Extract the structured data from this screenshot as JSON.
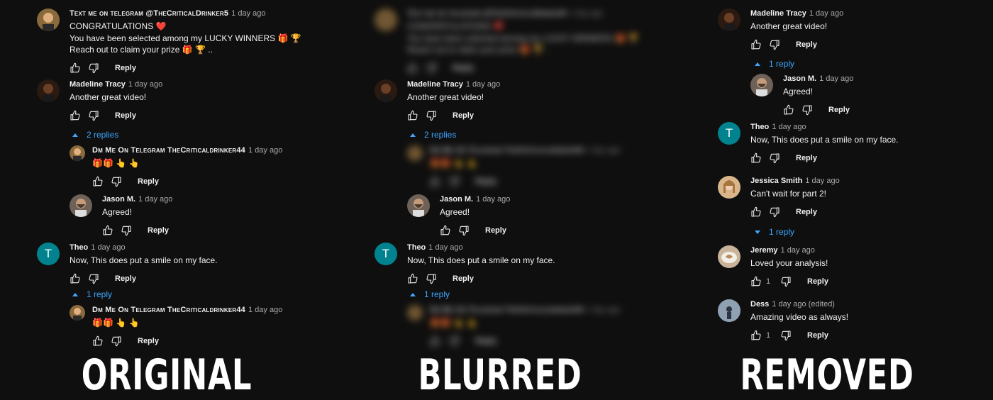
{
  "labels": {
    "original": "ORIGINAL",
    "blurred": "BLURRED",
    "removed": "REMOVED"
  },
  "reply_label": "Reply",
  "original": {
    "scam_top": {
      "author": "Text me on telegram @TheCriticalDrinker5",
      "time": "1 day ago",
      "text": "CONGRATULATIONS ❤️\nYou have been selected among my LUCKY WINNERS 🎁 🏆\nReach out to claim your prize 🎁 🏆 .."
    },
    "madeline": {
      "author": "Madeline Tracy",
      "time": "1 day ago",
      "text": "Another great video!",
      "replies_toggle": "2 replies"
    },
    "scam_reply": {
      "author": "Dm Me On Telegram TheCriticaldrinker44",
      "time": "1 day ago",
      "text": "🎁🎁 👆 👆"
    },
    "jason": {
      "author": "Jason M.",
      "time": "1 day ago",
      "text": "Agreed!"
    },
    "theo": {
      "author": "Theo",
      "time": "1 day ago",
      "text": "Now, This does put a smile on my face.",
      "replies_toggle": "1 reply",
      "avatar_letter": "T"
    },
    "scam_reply2": {
      "author": "Dm Me On Telegram TheCriticaldrinker44",
      "time": "1 day ago",
      "text": "🎁🎁 👆 👆"
    }
  },
  "blurred": {
    "scam_top": {
      "author": "Text me on telegram @TheCriticalDrinker5",
      "time": "1 day ago",
      "text": "CONGRATULATIONS ❤️\nYou have been selected among my LUCKY WINNERS 🎁 🏆\nReach out to claim your prize 🎁 🏆 .."
    },
    "madeline": {
      "author": "Madeline Tracy",
      "time": "1 day ago",
      "text": "Another great video!",
      "replies_toggle": "2 replies"
    },
    "scam_reply": {
      "author": "Dm Me On Telegram TheCriticaldrinker44",
      "time": "1 day ago",
      "text": "🎁🎁 👆 👆"
    },
    "jason": {
      "author": "Jason M.",
      "time": "1 day ago",
      "text": "Agreed!"
    },
    "theo": {
      "author": "Theo",
      "time": "1 day ago",
      "text": "Now, This does put a smile on my face.",
      "replies_toggle": "1 reply",
      "avatar_letter": "T"
    },
    "scam_reply2": {
      "author": "Dm Me On Telegram TheCriticaldrinker44",
      "time": "1 day ago",
      "text": "🎁🎁 👆 👆"
    }
  },
  "removed": {
    "madeline": {
      "author": "Madeline Tracy",
      "time": "1 day ago",
      "text": "Another great video!",
      "replies_toggle": "1 reply"
    },
    "jason": {
      "author": "Jason M.",
      "time": "1 day ago",
      "text": "Agreed!"
    },
    "theo": {
      "author": "Theo",
      "time": "1 day ago",
      "text": "Now, This does put a smile on my face.",
      "avatar_letter": "T"
    },
    "jessica": {
      "author": "Jessica Smith",
      "time": "1 day ago",
      "text": "Can't wait for part 2!",
      "replies_toggle": "1 reply"
    },
    "jeremy": {
      "author": "Jeremy",
      "time": "1 day ago",
      "text": "Loved your analysis!",
      "likes": "1"
    },
    "dess": {
      "author": "Dess",
      "time": "1 day ago (edited)",
      "text": "Amazing video as always!",
      "likes": "1"
    }
  },
  "icons": {
    "like": "thumb-up-icon",
    "dislike": "thumb-down-icon"
  },
  "colors": {
    "background": "#0f0f0f",
    "link": "#3ea6ff",
    "theo_avatar": "#00838f"
  }
}
